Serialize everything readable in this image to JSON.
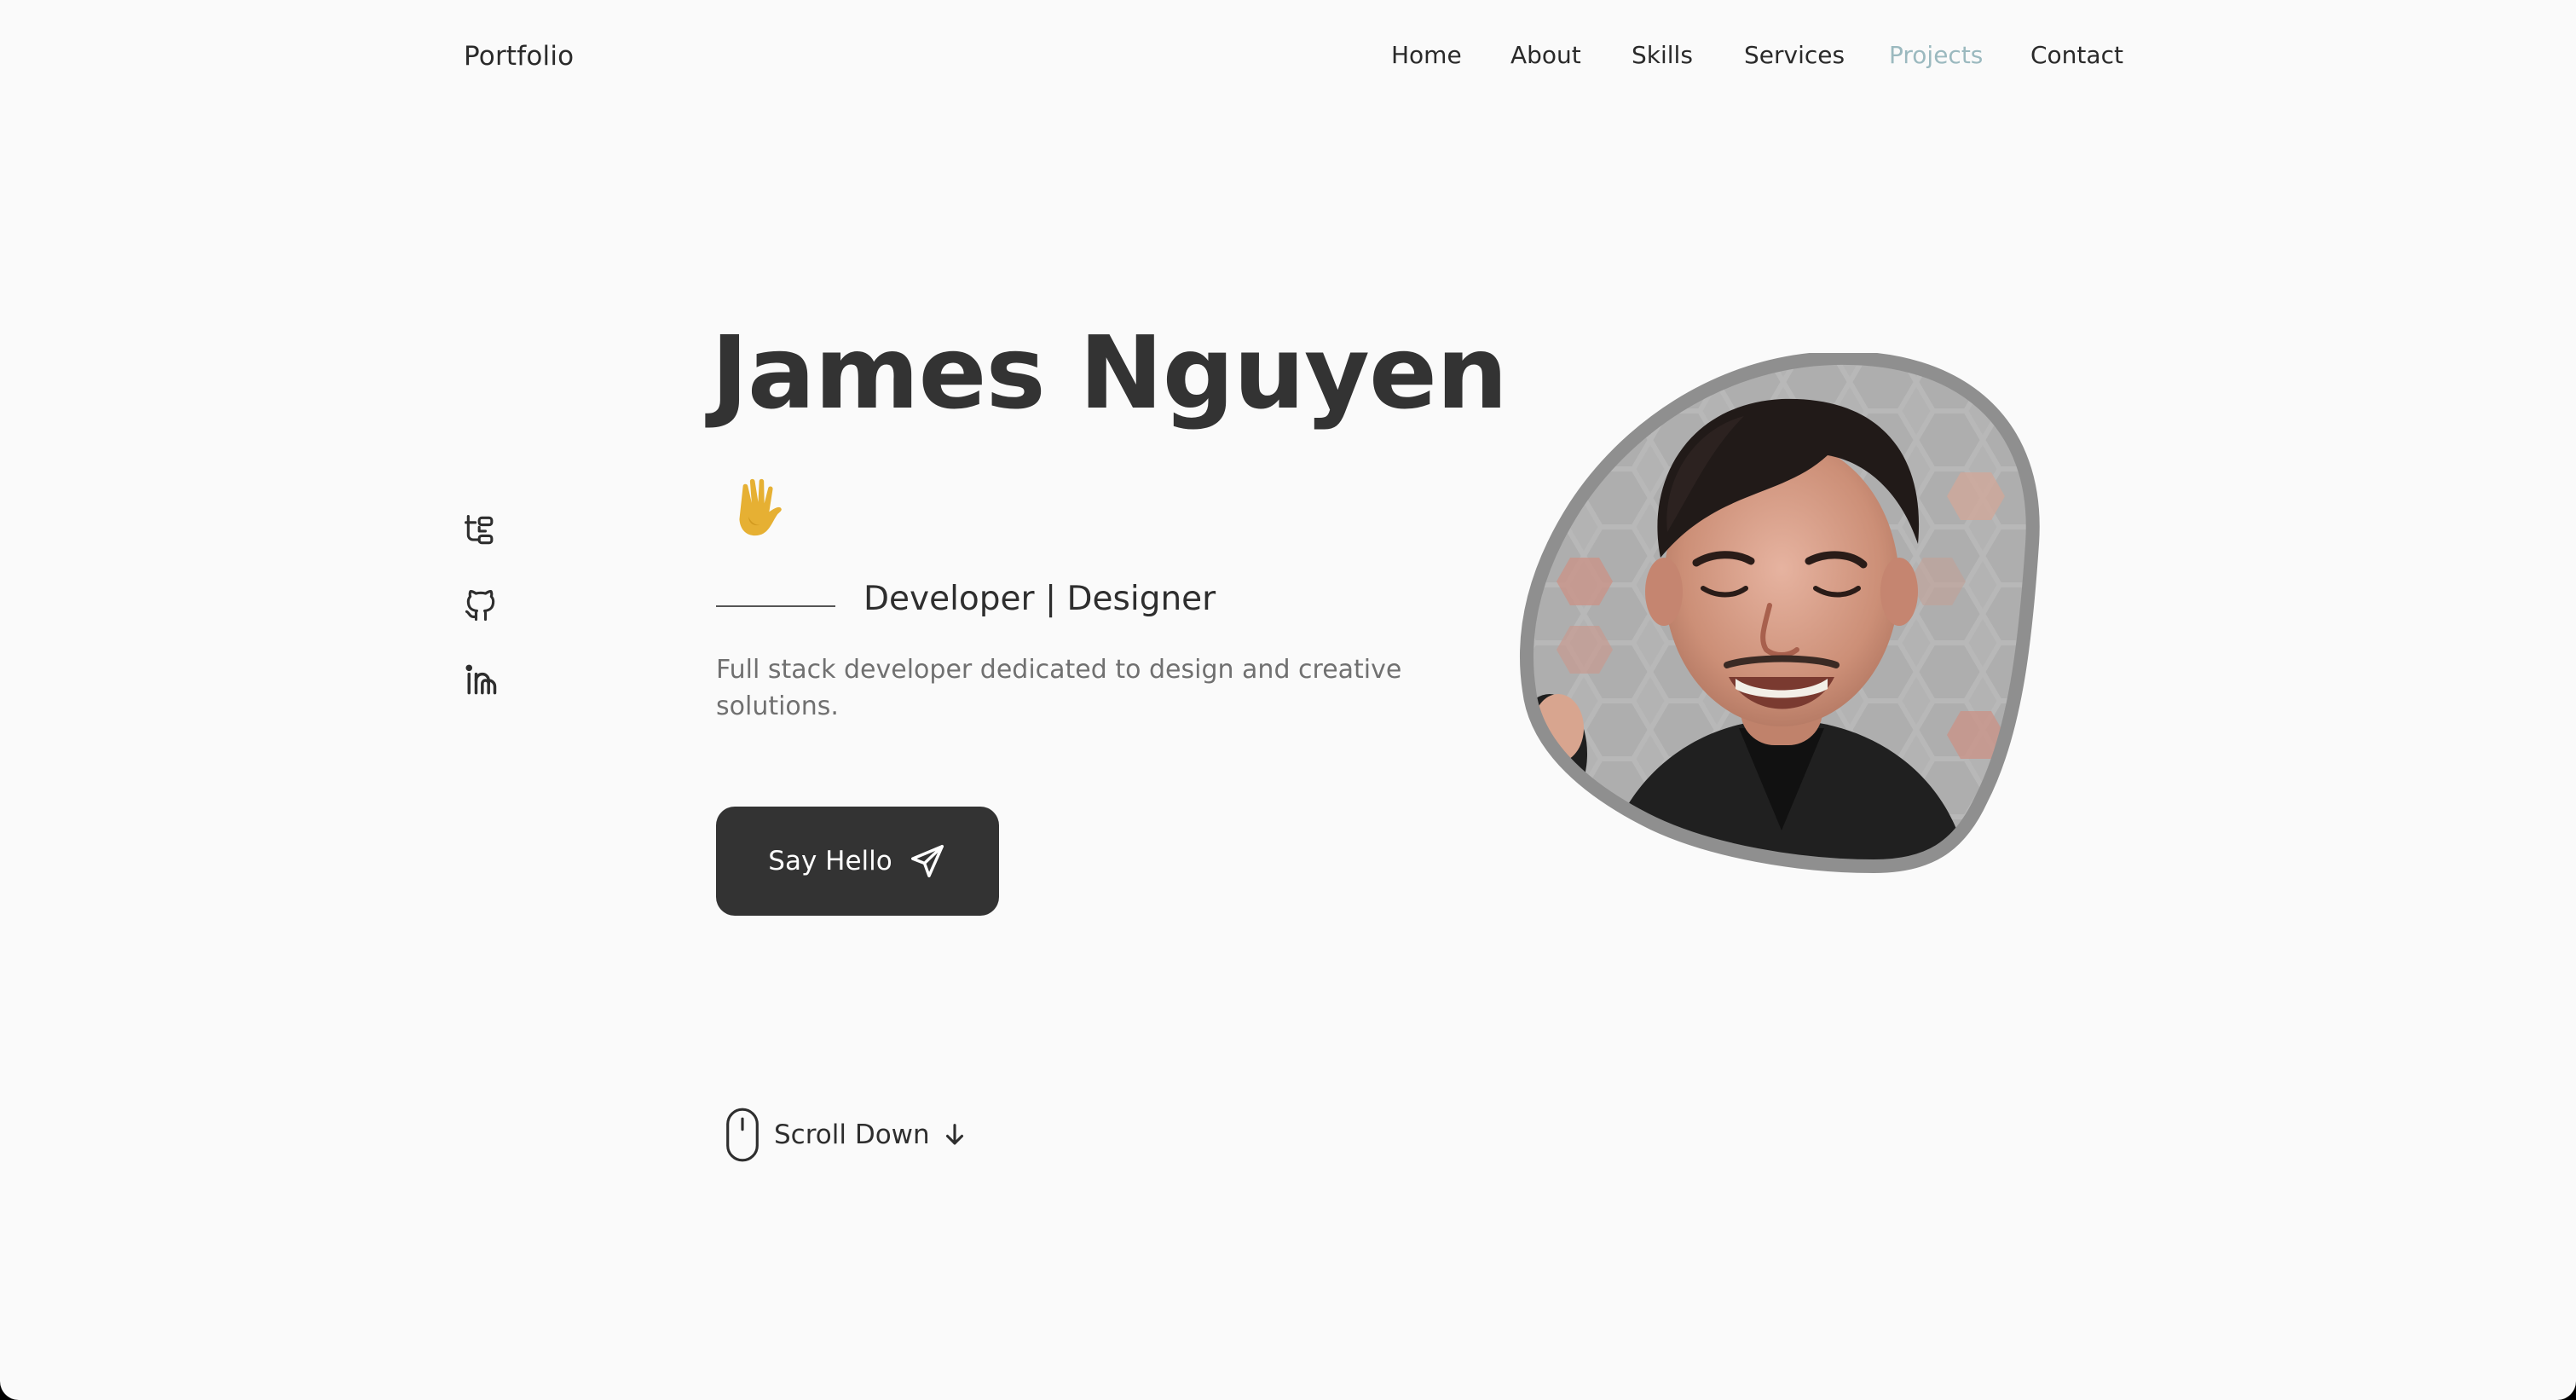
{
  "header": {
    "logo": "Portfolio",
    "nav": [
      {
        "label": "Home",
        "active": false
      },
      {
        "label": "About",
        "active": false
      },
      {
        "label": "Skills",
        "active": false
      },
      {
        "label": "Services",
        "active": false
      },
      {
        "label": "Projects",
        "active": true
      },
      {
        "label": "Contact",
        "active": false
      }
    ]
  },
  "social": [
    {
      "name": "tree-icon"
    },
    {
      "name": "github-icon"
    },
    {
      "name": "linkedin-icon"
    }
  ],
  "hero": {
    "name": "James Nguyen",
    "wave_icon": "waving-hand-icon",
    "subtitle": "Developer | Designer",
    "description": "Full stack developer dedicated to design and creative solutions.",
    "cta_label": "Say Hello",
    "cta_icon": "send-icon"
  },
  "scroll": {
    "label": "Scroll Down",
    "icon": "mouse-icon"
  },
  "colors": {
    "background": "#fafafa",
    "text": "#2e2e2e",
    "muted": "#707070",
    "active_nav": "#9bb9bf",
    "button_bg": "#333333",
    "wave": "#e6b033"
  }
}
